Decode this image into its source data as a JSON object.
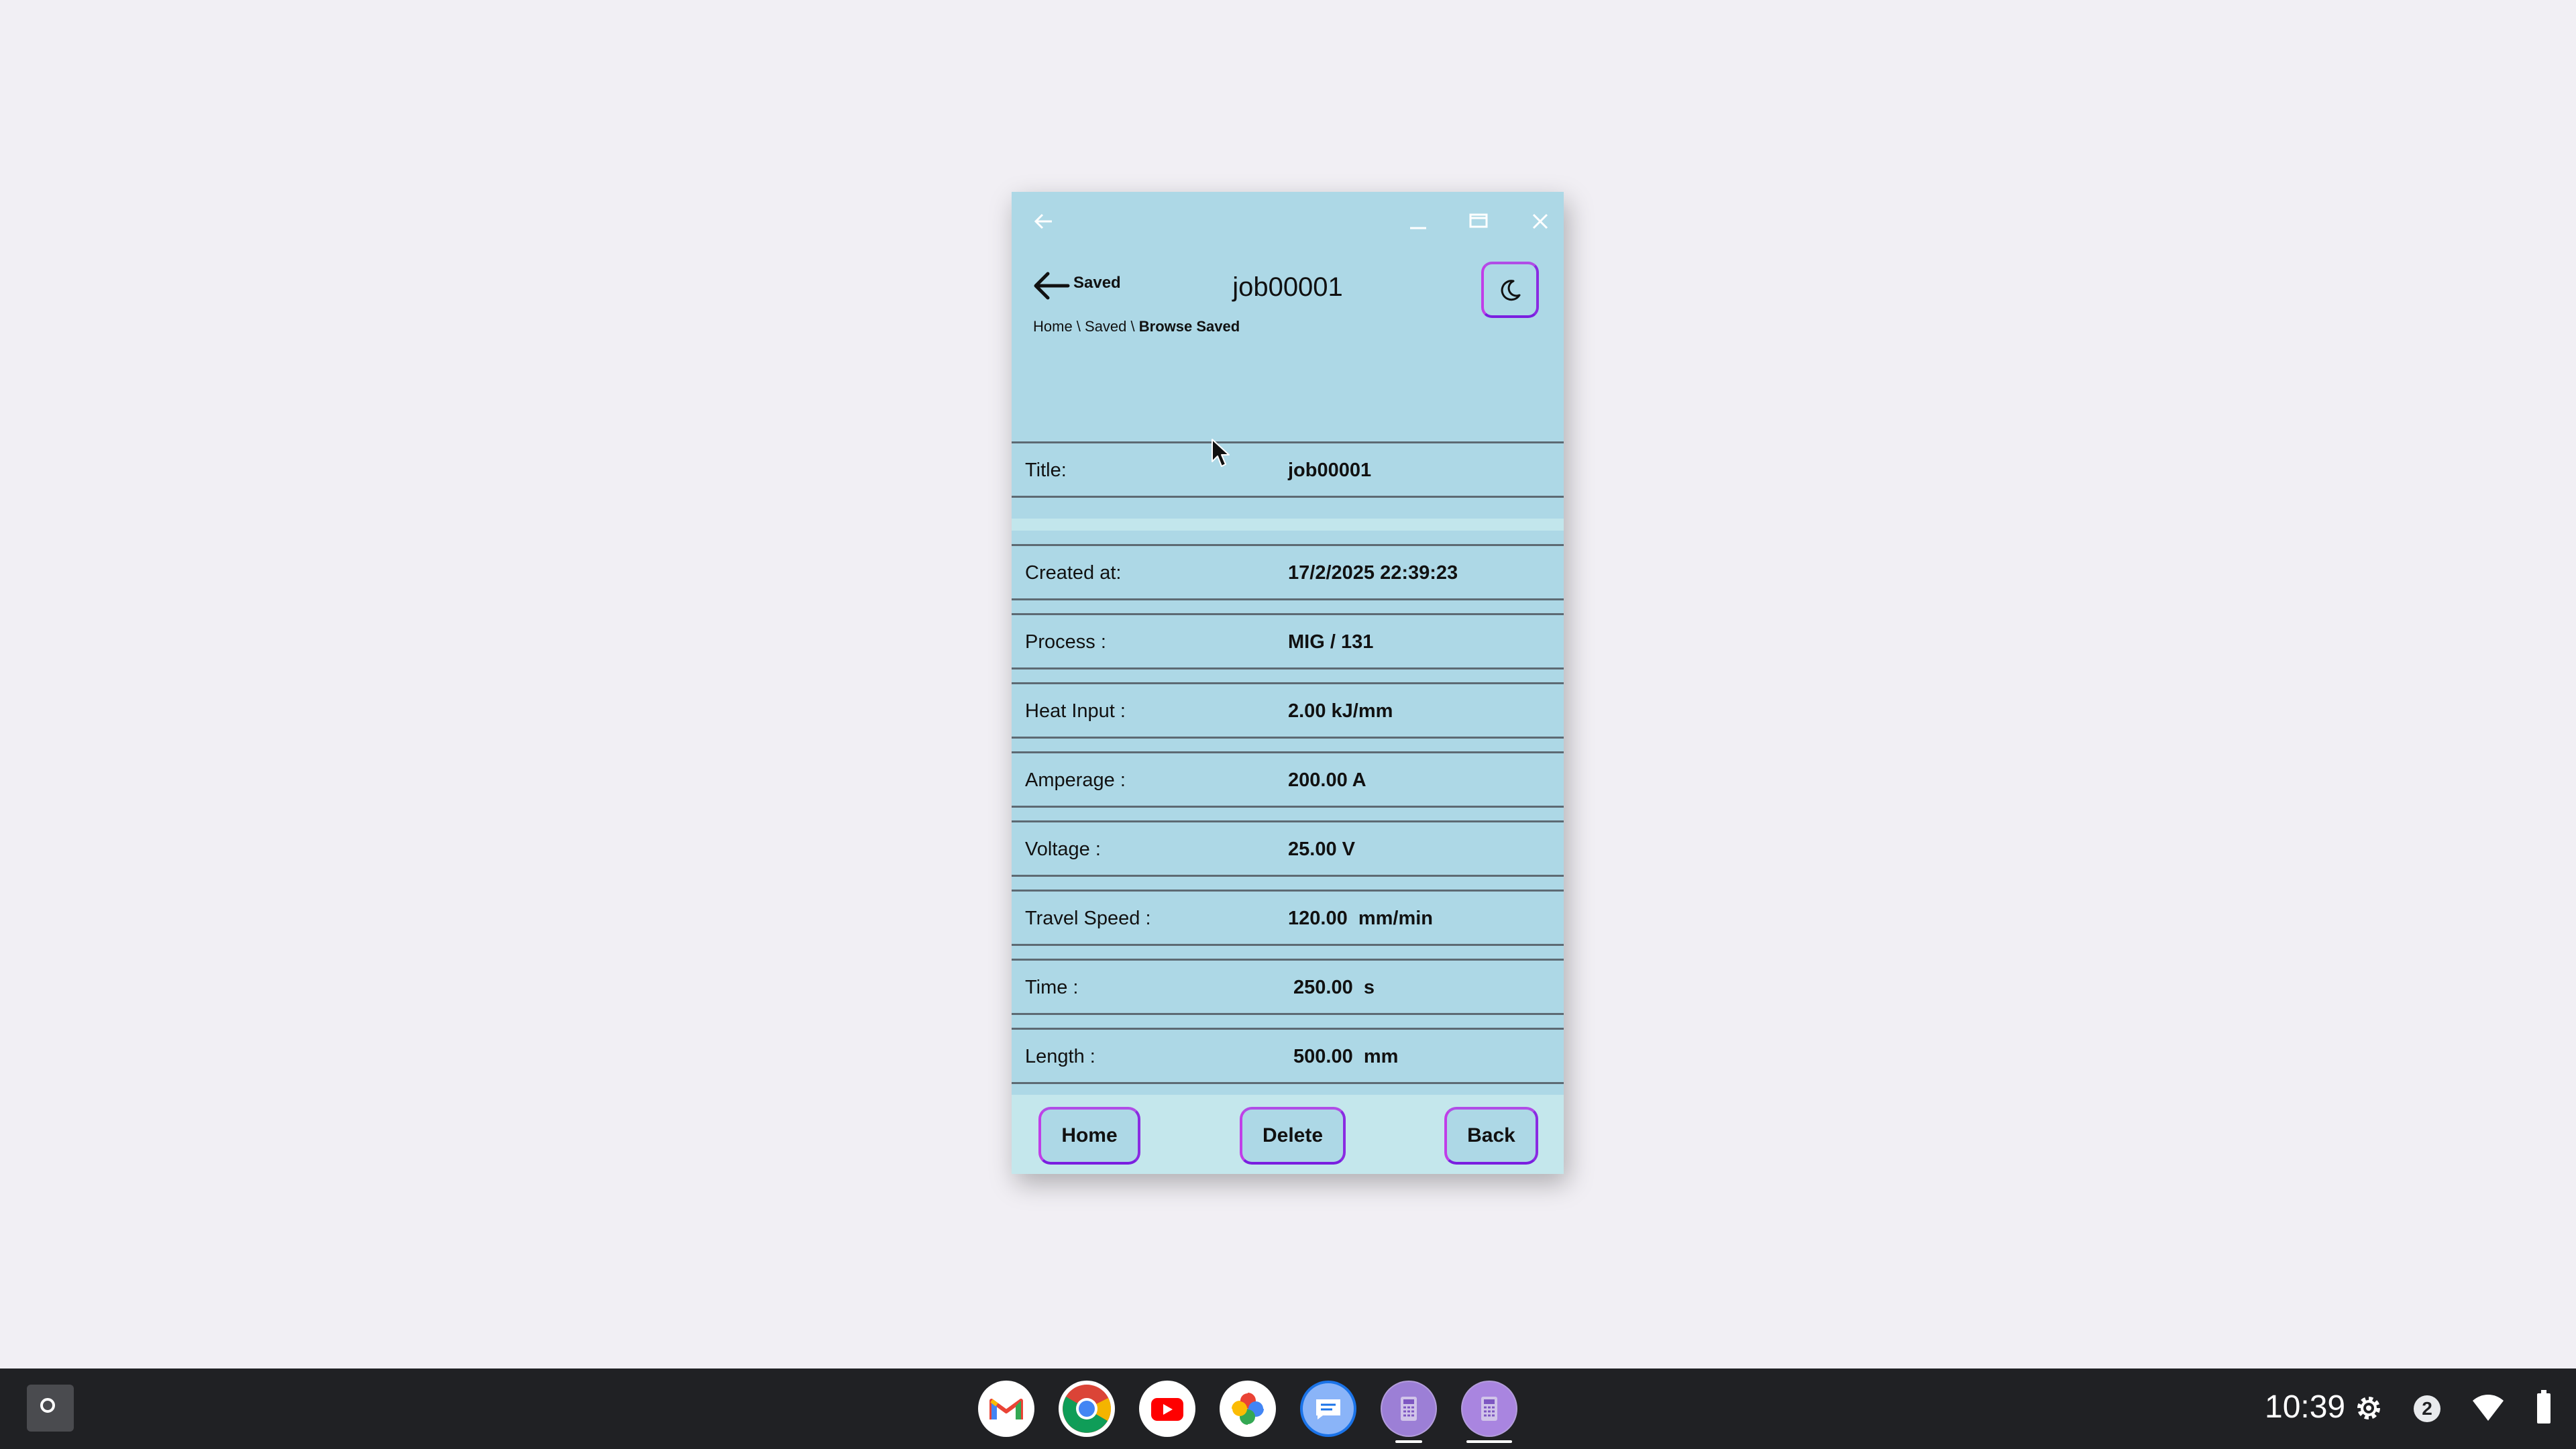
{
  "window": {
    "nav_back_label": "Saved",
    "title": "job00001",
    "breadcrumb": {
      "part1": "Home \\ Saved \\ ",
      "current": "Browse Saved"
    }
  },
  "rows": [
    {
      "label": "Title:",
      "value": "job00001"
    },
    {
      "label": "Created at:",
      "value": "17/2/2025 22:39:23"
    },
    {
      "label": "Process :",
      "value": "MIG / 131"
    },
    {
      "label": "Heat Input :",
      "value": "2.00 kJ/mm"
    },
    {
      "label": "Amperage :",
      "value": "200.00 A"
    },
    {
      "label": "Voltage :",
      "value": "25.00 V"
    },
    {
      "label": "Travel Speed :",
      "value": "120.00  mm/min"
    },
    {
      "label": "Time :",
      "value": "250.00  s"
    },
    {
      "label": "Length :",
      "value": "500.00  mm"
    }
  ],
  "footer": {
    "home": "Home",
    "delete": "Delete",
    "back": "Back"
  },
  "shelf": {
    "apps": [
      "gmail-icon",
      "chrome-icon",
      "youtube-icon",
      "photos-icon",
      "messages-icon",
      "calculator-app-icon",
      "calculator-app-active-icon"
    ],
    "time": "10:39",
    "notification_count": "2"
  },
  "colors": {
    "window_bg": "#add8e6",
    "footer_bg": "#c4e7ec",
    "button_border": "#8a2be2",
    "shelf_bg": "#202124"
  }
}
